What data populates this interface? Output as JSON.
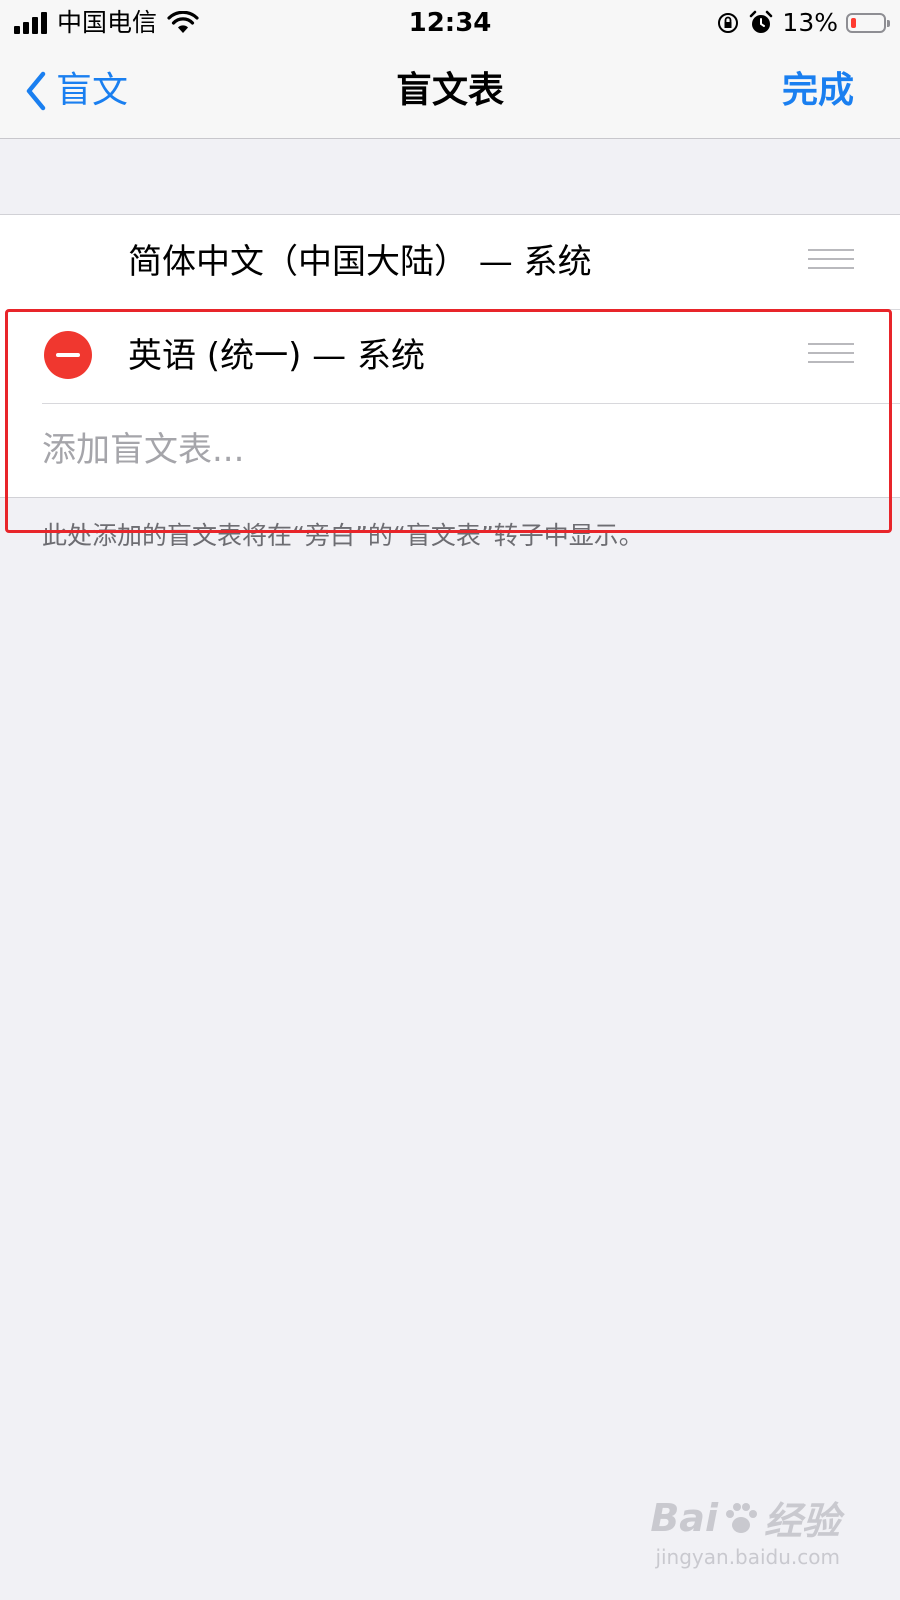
{
  "status_bar": {
    "carrier": "中国电信",
    "time": "12:34",
    "battery_percent": "13%",
    "battery_level": 0.13,
    "icons": [
      "signal-icon",
      "wifi-icon",
      "rotation-lock-icon",
      "alarm-icon",
      "battery-icon"
    ]
  },
  "nav": {
    "back_label": "盲文",
    "title": "盲文表",
    "done_label": "完成"
  },
  "list": {
    "rows": [
      {
        "label": "简体中文（中国大陆） — 系统",
        "deletable": false
      },
      {
        "label": "英语 (统一) — 系统",
        "deletable": true
      }
    ],
    "add_label": "添加盲文表..."
  },
  "footer_note": "此处添加的盲文表将在“旁白”的“盲文表”转子中显示。",
  "watermark": {
    "logo_text": "Bai",
    "logo_text_2": "经验",
    "url": "jingyan.baidu.com"
  },
  "colors": {
    "accent": "#1a7ff0",
    "delete": "#f0372f",
    "highlight": "#e8252a",
    "background": "#f1f1f5"
  }
}
